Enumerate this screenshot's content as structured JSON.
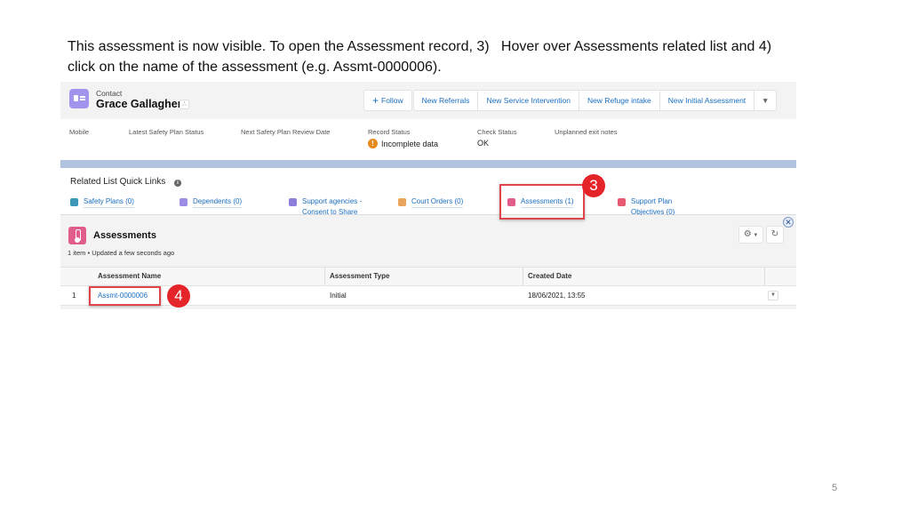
{
  "instruction": {
    "line1": "This assessment is now visible. To open the Assessment record, 3)   Hover over Assessments related list and 4)",
    "line2": "click on the name of the assessment (e.g. Assmt-0000006)."
  },
  "slide_number": "5",
  "record": {
    "object_type": "Contact",
    "name": "Grace Gallagher",
    "icon": "contact-card-icon",
    "hierarchy_icon": "hierarchy-icon"
  },
  "actions": {
    "follow": "Follow",
    "buttons": [
      "New Referrals",
      "New Service Intervention",
      "New Refuge intake",
      "New Initial Assessment"
    ],
    "more_icon": "chevron-down-icon"
  },
  "highlights": [
    {
      "label": "Mobile",
      "value": ""
    },
    {
      "label": "Latest Safety Plan Status",
      "value": ""
    },
    {
      "label": "Next Safety Plan Review Date",
      "value": ""
    },
    {
      "label": "Record Status",
      "value": "Incomplete data",
      "icon": "warning-icon"
    },
    {
      "label": "Check Status",
      "value": "OK"
    },
    {
      "label": "Unplanned exit notes",
      "value": ""
    }
  ],
  "quick_links": {
    "title": "Related List Quick Links",
    "items": [
      {
        "label": "Safety Plans (0)",
        "icon_color": "#3c97b8"
      },
      {
        "label": "Dependents (0)",
        "icon_color": "#9d8ce6"
      },
      {
        "label": "Support agencies - Consent to Share",
        "icon_color": "#8d7ddc"
      },
      {
        "label": "Court Orders (0)",
        "icon_color": "#e9a35a"
      },
      {
        "label": "Assessments (1)",
        "icon_color": "#e05d8c"
      },
      {
        "label": "Support Plan Objectives (0)",
        "icon_color": "#e55a70"
      }
    ]
  },
  "callouts": {
    "step3": "3",
    "step4": "4",
    "color": "#e5242a"
  },
  "related_list": {
    "title": "Assessments",
    "meta": "1 item • Updated a few seconds ago",
    "columns": [
      "Assessment Name",
      "Assessment Type",
      "Created Date"
    ],
    "rows": [
      {
        "index": "1",
        "name": "Assmt-0000006",
        "type": "Initial",
        "created": "18/06/2021, 13:55"
      }
    ]
  }
}
